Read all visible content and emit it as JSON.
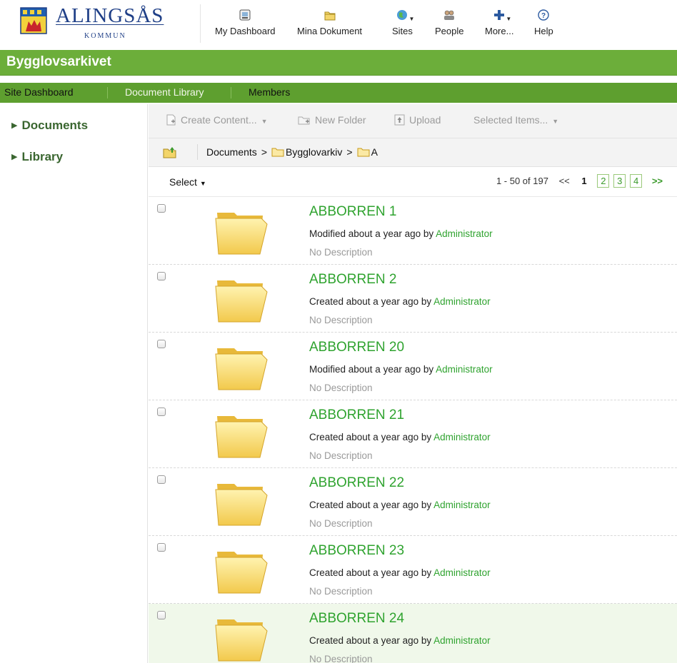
{
  "brand": {
    "name": "ALINGSÅS",
    "sub": "KOMMUN"
  },
  "nav": [
    {
      "label": "My Dashboard",
      "icon": "dashboard-icon"
    },
    {
      "label": "Mina Dokument",
      "icon": "documents-icon"
    },
    {
      "label": "Sites",
      "icon": "sites-globe-icon"
    },
    {
      "label": "People",
      "icon": "people-icon"
    },
    {
      "label": "More...",
      "icon": "plus-icon"
    },
    {
      "label": "Help",
      "icon": "help-icon"
    }
  ],
  "site": {
    "title": "Bygglovsarkivet",
    "tabs": [
      {
        "label": "Site Dashboard"
      },
      {
        "label": "Document Library"
      },
      {
        "label": "Members"
      }
    ]
  },
  "sidebar": {
    "items": [
      {
        "label": "Documents"
      },
      {
        "label": "Library"
      }
    ]
  },
  "toolbar": {
    "create": "Create Content...",
    "new_folder": "New Folder",
    "upload": "Upload",
    "selected": "Selected Items..."
  },
  "breadcrumb": {
    "root": "Documents",
    "level1": "Bygglovarkiv",
    "level2": "A",
    "separator": ">"
  },
  "list": {
    "select_label": "Select",
    "pager": {
      "range": "1 - 50 of 197",
      "prev": "<<",
      "current": "1",
      "pages": [
        "2",
        "3",
        "4"
      ],
      "next": ">>"
    },
    "rows": [
      {
        "name": "ABBORREN 1",
        "action": "Modified about a year ago by",
        "user": "Administrator",
        "description": "No Description"
      },
      {
        "name": "ABBORREN 2",
        "action": "Created about a year ago by",
        "user": "Administrator",
        "description": "No Description"
      },
      {
        "name": "ABBORREN 20",
        "action": "Modified about a year ago by",
        "user": "Administrator",
        "description": "No Description"
      },
      {
        "name": "ABBORREN 21",
        "action": "Created about a year ago by",
        "user": "Administrator",
        "description": "No Description"
      },
      {
        "name": "ABBORREN 22",
        "action": "Created about a year ago by",
        "user": "Administrator",
        "description": "No Description"
      },
      {
        "name": "ABBORREN 23",
        "action": "Created about a year ago by",
        "user": "Administrator",
        "description": "No Description"
      },
      {
        "name": "ABBORREN 24",
        "action": "Created about a year ago by",
        "user": "Administrator",
        "description": "No Description"
      }
    ]
  },
  "colors": {
    "accent_green": "#6cae3a",
    "link_green": "#2fa32f",
    "brand_blue": "#1f3f87"
  }
}
